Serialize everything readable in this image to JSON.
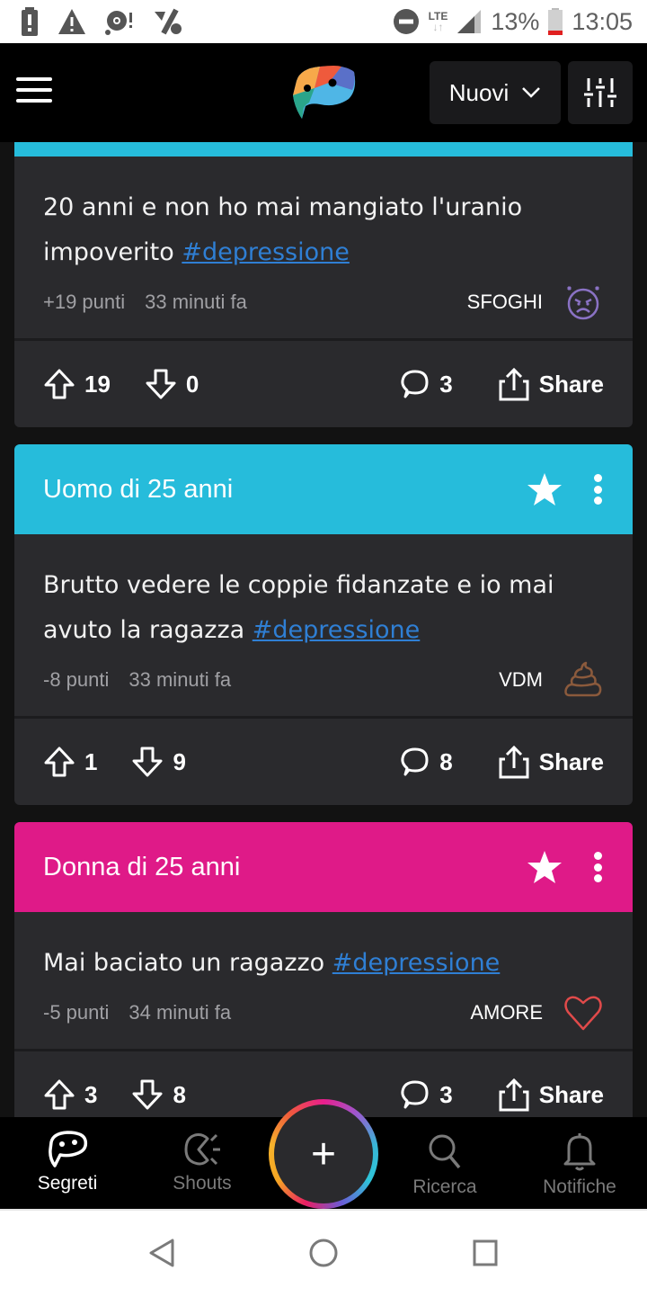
{
  "status_bar": {
    "left_icons": [
      "battery-alert-icon",
      "warning-icon",
      "disc-alert-icon",
      "data-saver-icon"
    ],
    "right_icons": [
      "do-not-disturb-icon",
      "lte-icon",
      "signal-icon",
      "battery-icon"
    ],
    "network": "LTE",
    "battery_percent": "13%",
    "time": "13:05"
  },
  "app_bar": {
    "menu_icon": "hamburger-menu-icon",
    "logo": "speech-bubble-logo",
    "sort_label": "Nuovi",
    "filter_icon": "sliders-icon"
  },
  "colors": {
    "male_header": "#26bcdb",
    "female_header": "#df1a88",
    "card_bg": "#2a2a2d",
    "hashtag": "#2f7fd4",
    "sfoghi_icon": "#8a72c4",
    "vdm_icon": "#8b5a3c",
    "amore_icon": "#e04a4a"
  },
  "posts": [
    {
      "header": "",
      "header_color": "#26bcdb",
      "text": "20 anni e non ho mai mangiato l'uranio impoverito ",
      "hashtag": "#depressione",
      "points": "+19 punti",
      "time": "33 minuti fa",
      "category": "SFOGHI",
      "category_icon": "angry-face-icon",
      "upvotes": "19",
      "downvotes": "0",
      "comments": "3",
      "share_label": "Share"
    },
    {
      "header": "Uomo di 25 anni",
      "header_color": "#26bcdb",
      "text": "Brutto vedere le coppie fidanzate e io mai avuto la ragazza ",
      "hashtag": "#depressione",
      "points": "-8 punti",
      "time": "33 minuti fa",
      "category": "VDM",
      "category_icon": "poop-icon",
      "upvotes": "1",
      "downvotes": "9",
      "comments": "8",
      "share_label": "Share"
    },
    {
      "header": "Donna di 25 anni",
      "header_color": "#df1a88",
      "text": "Mai baciato un ragazzo ",
      "hashtag": "#depressione",
      "points": "-5 punti",
      "time": "34 minuti fa",
      "category": "AMORE",
      "category_icon": "heart-icon",
      "upvotes": "3",
      "downvotes": "8",
      "comments": "3",
      "share_label": "Share"
    }
  ],
  "bottom_nav": {
    "items": [
      {
        "label": "Segreti",
        "icon": "secret-bubble-icon",
        "active": true
      },
      {
        "label": "Shouts",
        "icon": "shouts-icon",
        "active": false
      },
      {
        "label": "Ricerca",
        "icon": "search-icon",
        "active": false
      },
      {
        "label": "Notifiche",
        "icon": "bell-icon",
        "active": false
      }
    ],
    "fab_label": "+"
  },
  "system_nav": [
    "back-icon",
    "home-icon",
    "recents-icon"
  ]
}
